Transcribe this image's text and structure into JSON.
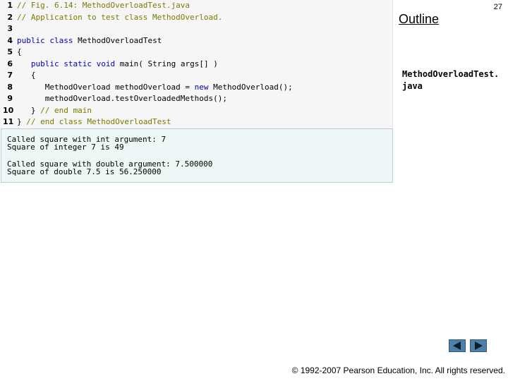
{
  "slide": {
    "page_number": "27",
    "outline_title": "Outline",
    "file_label": "MethodOverloadTest.java",
    "copyright": "© 1992-2007 Pearson Education, Inc.  All rights reserved."
  },
  "code_lines": [
    {
      "num": "1",
      "text": "// Fig. 6.14: MethodOverloadTest.java"
    },
    {
      "num": "2",
      "text": "// Application to test class MethodOverload."
    },
    {
      "num": "3",
      "text": ""
    },
    {
      "num": "4",
      "text": "public class MethodOverloadTest"
    },
    {
      "num": "5",
      "text": "{"
    },
    {
      "num": "6",
      "text": "   public static void main( String args[] )"
    },
    {
      "num": "7",
      "text": "   {"
    },
    {
      "num": "8",
      "text": "      MethodOverload methodOverload = new MethodOverload();"
    },
    {
      "num": "9",
      "text": "      methodOverload.testOverloadedMethods();"
    },
    {
      "num": "10",
      "text": "   } // end main"
    },
    {
      "num": "11",
      "text": "} // end class MethodOverloadTest"
    }
  ],
  "output_lines": [
    "Called square with int argument: 7",
    "Square of integer 7 is 49",
    "",
    "Called square with double argument: 7.500000",
    "Square of double 7.5 is 56.250000"
  ],
  "nav": {
    "prev_icon": "triangle-left-icon",
    "next_icon": "triangle-right-icon"
  },
  "colors": {
    "keyword": "#0000c0",
    "comment": "#7a7a00",
    "nav_button": "#4e7fa7"
  }
}
